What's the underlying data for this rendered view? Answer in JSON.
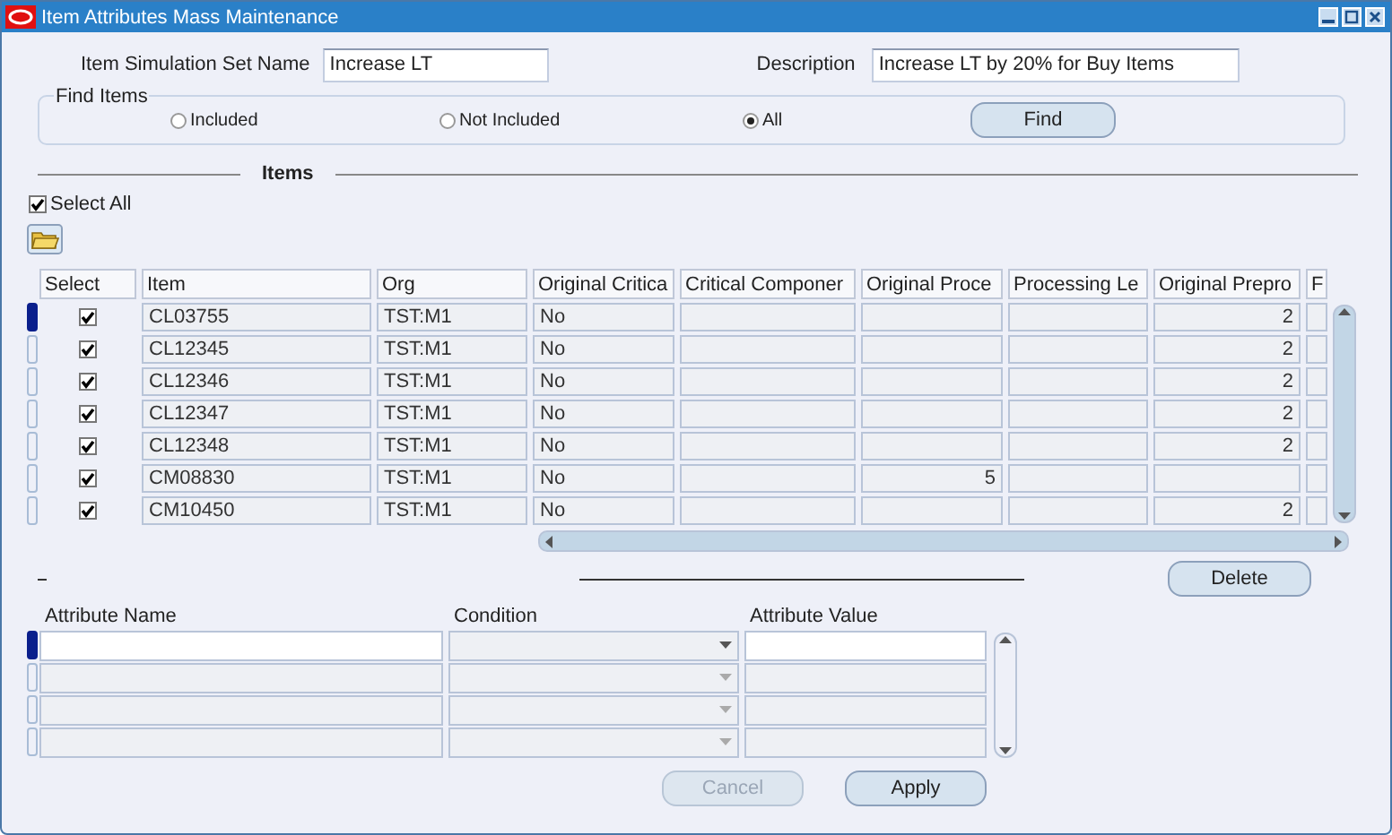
{
  "window": {
    "title": "Item Attributes Mass Maintenance"
  },
  "header": {
    "set_name_label": "Item Simulation Set Name",
    "set_name": "Increase LT",
    "description_label": "Description",
    "description": "Increase LT by 20% for Buy Items"
  },
  "find_items": {
    "legend": "Find Items",
    "options": [
      {
        "label": "Included",
        "selected": false
      },
      {
        "label": "Not Included",
        "selected": false
      },
      {
        "label": "All",
        "selected": true
      }
    ],
    "button": "Find"
  },
  "items_section": {
    "title": "Items",
    "select_all": {
      "label": "Select All",
      "checked": true
    }
  },
  "table": {
    "columns": [
      "Select",
      "Item",
      "Org",
      "Original Critica",
      "Critical Componer",
      "Original Proce",
      "Processing Le",
      "Original Prepro",
      "F"
    ],
    "rows": [
      {
        "selected": true,
        "checked": true,
        "item": "CL03755",
        "org": "TST:M1",
        "original_critical": "No",
        "original_preprocessing": "2"
      },
      {
        "selected": false,
        "checked": true,
        "item": "CL12345",
        "org": "TST:M1",
        "original_critical": "No",
        "original_preprocessing": "2"
      },
      {
        "selected": false,
        "checked": true,
        "item": "CL12346",
        "org": "TST:M1",
        "original_critical": "No",
        "original_preprocessing": "2"
      },
      {
        "selected": false,
        "checked": true,
        "item": "CL12347",
        "org": "TST:M1",
        "original_critical": "No",
        "original_preprocessing": "2"
      },
      {
        "selected": false,
        "checked": true,
        "item": "CL12348",
        "org": "TST:M1",
        "original_critical": "No",
        "original_preprocessing": "2"
      },
      {
        "selected": false,
        "checked": true,
        "item": "CM08830",
        "org": "TST:M1",
        "original_critical": "No",
        "original_processing": "5"
      },
      {
        "selected": false,
        "checked": true,
        "item": "CM10450",
        "org": "TST:M1",
        "original_critical": "No",
        "original_preprocessing": "2"
      }
    ]
  },
  "delete_button": "Delete",
  "attributes": {
    "columns": [
      "Attribute Name",
      "Condition",
      "Attribute Value"
    ],
    "rows": [
      {
        "selected": true
      },
      {
        "selected": false
      },
      {
        "selected": false
      },
      {
        "selected": false
      }
    ]
  },
  "buttons": [
    {
      "label": "Cancel",
      "disabled": true
    },
    {
      "label": "Apply",
      "disabled": false
    }
  ]
}
